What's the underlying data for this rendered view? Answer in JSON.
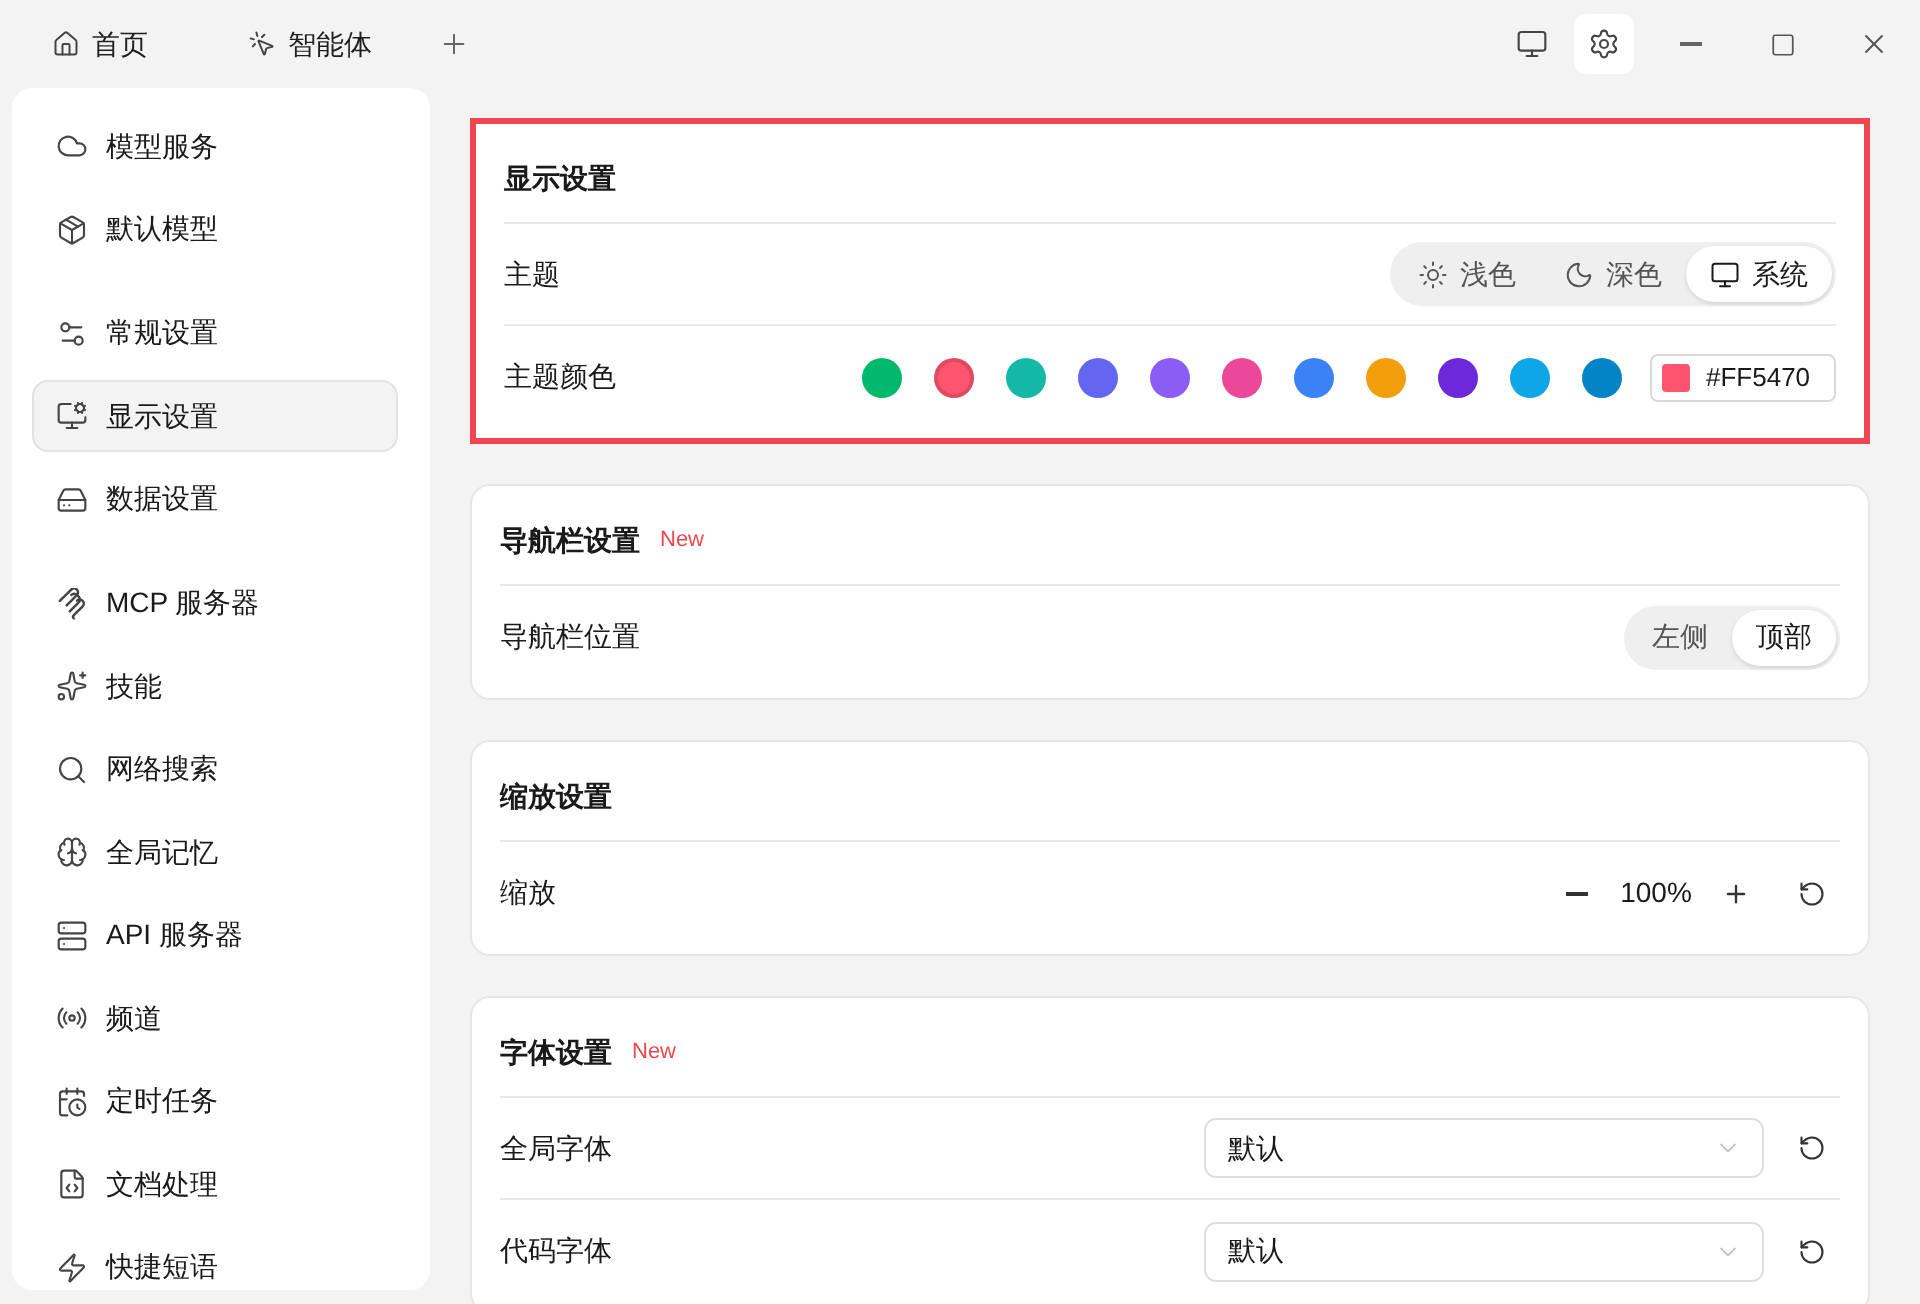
{
  "title_bar": {
    "tabs": [
      {
        "label": "首页"
      },
      {
        "label": "智能体"
      }
    ],
    "actions": [
      {
        "selected": false
      },
      {
        "selected": true
      }
    ]
  },
  "sidebar": {
    "groups": [
      {
        "items": [
          {
            "label": "模型服务",
            "selected": false
          },
          {
            "label": "默认模型",
            "selected": false
          }
        ]
      },
      {
        "items": [
          {
            "label": "常规设置",
            "selected": false
          },
          {
            "label": "显示设置",
            "selected": true
          },
          {
            "label": "数据设置",
            "selected": false
          }
        ]
      },
      {
        "items": [
          {
            "label": "MCP 服务器",
            "selected": false
          },
          {
            "label": "技能",
            "selected": false
          },
          {
            "label": "网络搜索",
            "selected": false
          },
          {
            "label": "全局记忆",
            "selected": false
          },
          {
            "label": "API 服务器",
            "selected": false
          },
          {
            "label": "频道",
            "selected": false
          },
          {
            "label": "定时任务",
            "selected": false
          },
          {
            "label": "文档处理",
            "selected": false
          },
          {
            "label": "快捷短语",
            "selected": false
          }
        ]
      }
    ]
  },
  "sections": [
    {
      "title": "显示设置",
      "highlighted": true,
      "rows": [
        {
          "kind": "modes",
          "label": "主题",
          "options": [
            {
              "label": "浅色",
              "selected": false
            },
            {
              "label": "深色",
              "selected": false
            },
            {
              "label": "系统",
              "selected": true
            }
          ]
        },
        {
          "kind": "colors",
          "label": "主题颜色",
          "swatches": [
            {
              "color": "#00b96b",
              "selected": false
            },
            {
              "color": "#ff5470",
              "selected": true
            },
            {
              "color": "#14b8a6",
              "selected": false
            },
            {
              "color": "#6366f1",
              "selected": false
            },
            {
              "color": "#8b5cf6",
              "selected": false
            },
            {
              "color": "#ec4899",
              "selected": false
            },
            {
              "color": "#3b82f6",
              "selected": false
            },
            {
              "color": "#f59e0b",
              "selected": false
            },
            {
              "color": "#6d28d9",
              "selected": false
            },
            {
              "color": "#0ea5e9",
              "selected": false
            },
            {
              "color": "#0284c7",
              "selected": false
            }
          ],
          "value": "#FF5470"
        }
      ]
    },
    {
      "title": "导航栏设置",
      "badge": "New",
      "highlighted": false,
      "rows": [
        {
          "kind": "toggle",
          "label": "导航栏位置",
          "options": [
            {
              "label": "左侧",
              "selected": false
            },
            {
              "label": "顶部",
              "selected": true
            }
          ]
        }
      ]
    },
    {
      "title": "缩放设置",
      "highlighted": false,
      "rows": [
        {
          "kind": "stepper",
          "label": "缩放",
          "value": "100%"
        }
      ]
    },
    {
      "title": "字体设置",
      "badge": "New",
      "highlighted": false,
      "rows": [
        {
          "kind": "select",
          "label": "全局字体",
          "value": "默认"
        },
        {
          "kind": "select",
          "label": "代码字体",
          "value": "默认"
        }
      ]
    }
  ]
}
